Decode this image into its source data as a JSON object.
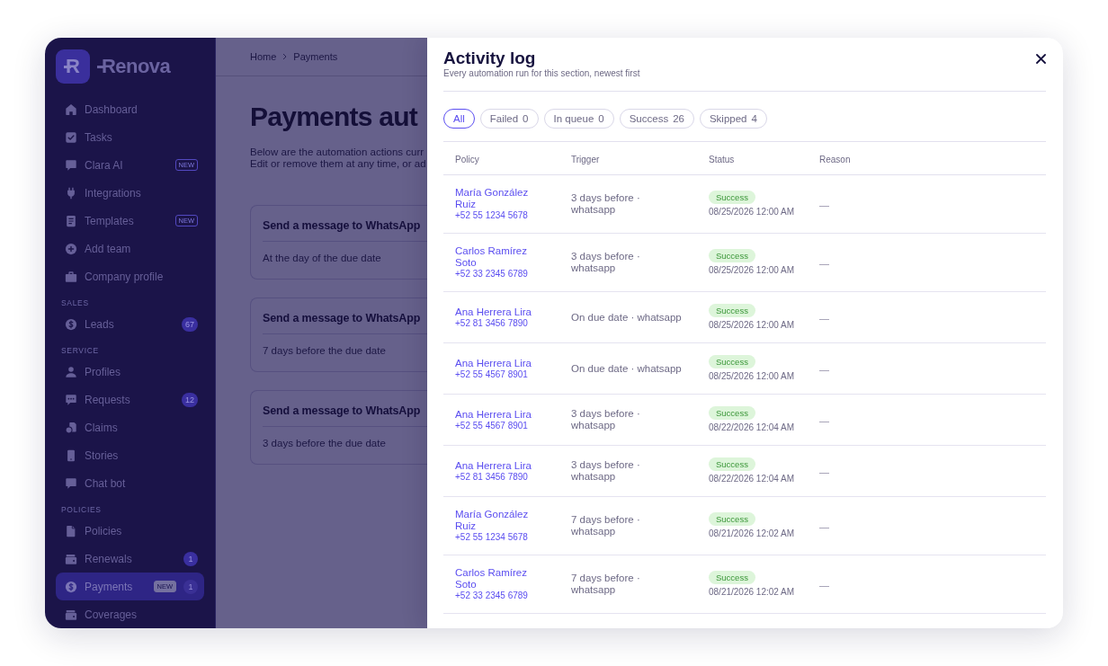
{
  "sidebar": {
    "logo": {
      "mark": "R",
      "wordmark": "Renova"
    },
    "groups": [
      {
        "items": [
          {
            "label": "Dashboard",
            "selected": false
          },
          {
            "label": "Tasks",
            "selected": false
          },
          {
            "label": "Clara AI",
            "tag": "NEW",
            "selected": false
          },
          {
            "label": "Integrations",
            "selected": false
          },
          {
            "label": "Templates",
            "tag": "NEW",
            "selected": false
          },
          {
            "label": "Add team",
            "selected": false
          },
          {
            "label": "Company profile",
            "selected": false
          }
        ]
      },
      {
        "label": "SALES",
        "items": [
          {
            "label": "Leads",
            "count": "67",
            "selected": false
          }
        ]
      },
      {
        "label": "SERVICE",
        "items": [
          {
            "label": "Profiles",
            "selected": false
          },
          {
            "label": "Requests",
            "count": "12",
            "selected": false
          },
          {
            "label": "Claims",
            "selected": false
          },
          {
            "label": "Stories",
            "selected": false
          },
          {
            "label": "Chat bot",
            "selected": false
          }
        ]
      },
      {
        "label": "POLICIES",
        "items": [
          {
            "label": "Policies",
            "selected": false
          },
          {
            "label": "Renewals",
            "count": "1",
            "selected": false
          },
          {
            "label": "Payments",
            "tag": "NEW",
            "count": "1",
            "selected": true
          },
          {
            "label": "Coverages",
            "selected": false
          }
        ]
      }
    ]
  },
  "main": {
    "breadcrumb": [
      "Home",
      "Payments"
    ],
    "title": "Payments aut",
    "description": "Below are the automation actions curr\nEdit or remove them at any time, or ad",
    "cards": [
      {
        "title": "Send a message to WhatsApp",
        "subtitle": "At the day of the due date"
      },
      {
        "title": "Send a message to WhatsApp",
        "subtitle": "7 days before the due date"
      },
      {
        "title": "Send a message to WhatsApp",
        "subtitle": "3 days before the due date"
      }
    ]
  },
  "activity_log": {
    "title": "Activity log",
    "subtitle": "Every automation run for this section, newest first",
    "filters": [
      {
        "label": "All",
        "selected": true
      },
      {
        "label": "Failed",
        "count": "0",
        "selected": false
      },
      {
        "label": "In queue",
        "count": "0",
        "selected": false
      },
      {
        "label": "Success",
        "count": "26",
        "selected": false
      },
      {
        "label": "Skipped",
        "count": "4",
        "selected": false
      }
    ],
    "table": {
      "columns": [
        "Policy",
        "Trigger",
        "Status",
        "Reason"
      ],
      "rows": [
        {
          "name": "María González Ruiz",
          "phone": "+52 55 1234 5678",
          "trigger": "3 days before · whatsapp",
          "status": "Success",
          "time": "08/25/2026 12:00 AM",
          "reason": "—"
        },
        {
          "name": "Carlos Ramírez Soto",
          "phone": "+52 33 2345 6789",
          "trigger": "3 days before · whatsapp",
          "status": "Success",
          "time": "08/25/2026 12:00 AM",
          "reason": "—"
        },
        {
          "name": "Ana Herrera Lira",
          "phone": "+52 81 3456 7890",
          "trigger": "On due date · whatsapp",
          "status": "Success",
          "time": "08/25/2026 12:00 AM",
          "reason": "—"
        },
        {
          "name": "Ana Herrera Lira",
          "phone": "+52 55 4567 8901",
          "trigger": "On due date · whatsapp",
          "status": "Success",
          "time": "08/25/2026 12:00 AM",
          "reason": "—"
        },
        {
          "name": "Ana Herrera Lira",
          "phone": "+52 55 4567 8901",
          "trigger": "3 days before · whatsapp",
          "status": "Success",
          "time": "08/22/2026 12:04 AM",
          "reason": "—"
        },
        {
          "name": "Ana Herrera Lira",
          "phone": "+52 81 3456 7890",
          "trigger": "3 days before · whatsapp",
          "status": "Success",
          "time": "08/22/2026 12:04 AM",
          "reason": "—"
        },
        {
          "name": "María González Ruiz",
          "phone": "+52 55 1234 5678",
          "trigger": "7 days before · whatsapp",
          "status": "Success",
          "time": "08/21/2026 12:02 AM",
          "reason": "—"
        },
        {
          "name": "Carlos Ramírez Soto",
          "phone": "+52 33 2345 6789",
          "trigger": "7 days before · whatsapp",
          "status": "Success",
          "time": "08/21/2026 12:02 AM",
          "reason": "—"
        }
      ]
    }
  }
}
